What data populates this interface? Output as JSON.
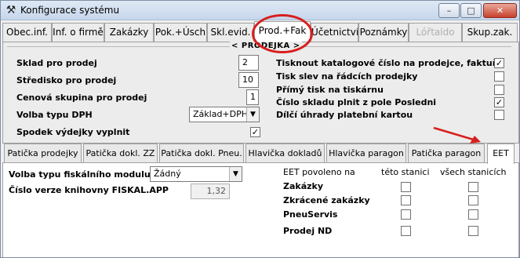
{
  "window": {
    "title": "Konfigurace systému",
    "app_icon": "tools-icon",
    "controls": {
      "minimize": "–",
      "maximize": "□",
      "close": "✕"
    }
  },
  "top_tabs": [
    {
      "label": "Obec.inf."
    },
    {
      "label": "Inf. o firmě"
    },
    {
      "label": "Zakázky"
    },
    {
      "label": "Pok.+Úsch"
    },
    {
      "label": "Skl.evid."
    },
    {
      "label": "Prod.+Fak"
    },
    {
      "label": "Účetnictví"
    },
    {
      "label": "Poznámky"
    },
    {
      "label": "Lóřtaldo"
    },
    {
      "label": "Skup.zak."
    }
  ],
  "section": {
    "legend": "< PRODEJKA >"
  },
  "prodejka_left": {
    "sklad_label": "Sklad pro prodej",
    "sklad_value": "2",
    "stredisko_label": "Středisko pro prodej",
    "stredisko_value": "10",
    "cenova_label": "Cenová skupina pro prodej",
    "cenova_value": "1",
    "volba_dph_label": "Volba typu DPH",
    "volba_dph_value": "Základ+DPH",
    "spodek_label": "Spodek výdejky vyplnit",
    "spodek_checked": "✓"
  },
  "prodejka_right": {
    "tisknout_label": "Tisknout katalogové číslo na prodejce, faktuře",
    "tisknout_checked": "✓",
    "tisk_slev_label": "Tisk slev na řádcích prodejky",
    "tisk_slev_checked": "",
    "primy_tisk_label": "Přímý tisk na tiskárnu",
    "primy_tisk_checked": "",
    "cislo_skladu_label": "Číslo skladu plnit z pole Posledni",
    "cislo_skladu_checked": "✓",
    "dilci_label": "Dílčí úhrady platební kartou",
    "dilci_checked": ""
  },
  "bottom_tabs": [
    {
      "label": "Patička prodejky"
    },
    {
      "label": "Patička dokl. ZZ"
    },
    {
      "label": "Patička dokl. Pneu."
    },
    {
      "label": "Hlavička dokladů"
    },
    {
      "label": "Hlavička paragon"
    },
    {
      "label": "Patička paragon"
    },
    {
      "label": "EET"
    }
  ],
  "eet": {
    "fiskal_label": "Volba typu fiskálního modulu",
    "fiskal_value": "Žádný",
    "verze_label": "Číslo verze knihovny FISKAL.APP",
    "verze_value": "1,32",
    "povoleno_label": "EET povoleno na",
    "col_this": "této stanici",
    "col_all": "všech stanicích",
    "rows": [
      {
        "label": "Zakázky"
      },
      {
        "label": "Zkrácené zakázky"
      },
      {
        "label": "PneuServis"
      },
      {
        "label": "Prodej ND"
      }
    ]
  },
  "annotations": {
    "highlight_color": "#d81e1e"
  }
}
